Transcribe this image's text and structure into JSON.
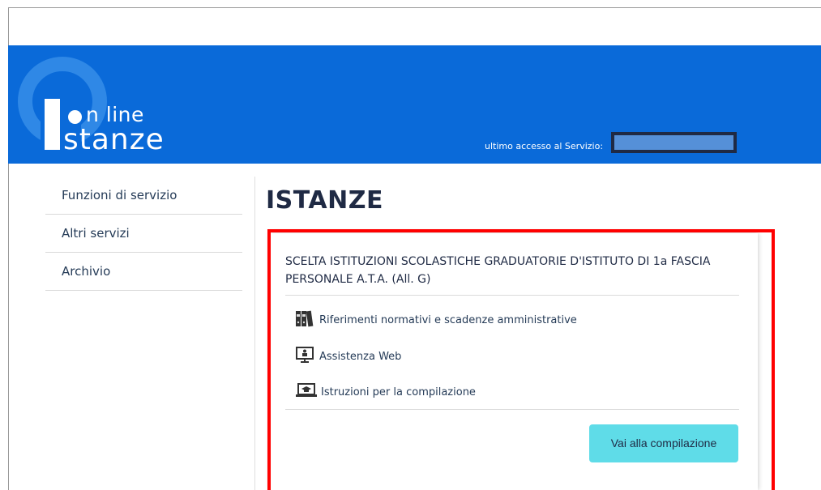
{
  "header": {
    "logo_online": "n line",
    "logo_stanze": "stanze",
    "last_access_label": "ultimo accesso al Servizio:",
    "colors": {
      "background": "#0a6ad9"
    }
  },
  "sidebar": {
    "items": [
      {
        "label": "Funzioni di servizio"
      },
      {
        "label": "Altri servizi"
      },
      {
        "label": "Archivio"
      }
    ]
  },
  "main": {
    "title": "ISTANZE",
    "card": {
      "title": "SCELTA ISTITUZIONI SCOLASTICHE GRADUATORIE D'ISTITUTO DI 1a FASCIA PERSONALE A.T.A. (All. G)",
      "links": [
        {
          "label": "Riferimenti normativi e scadenze amministrative",
          "icon": "binders-icon"
        },
        {
          "label": "Assistenza Web",
          "icon": "monitor-person-icon"
        },
        {
          "label": "Istruzioni per la compilazione",
          "icon": "laptop-graduation-icon"
        }
      ],
      "button_label": "Vai alla compilazione",
      "colors": {
        "button": "#5fdce8",
        "highlight_border": "#ff0000"
      }
    }
  }
}
